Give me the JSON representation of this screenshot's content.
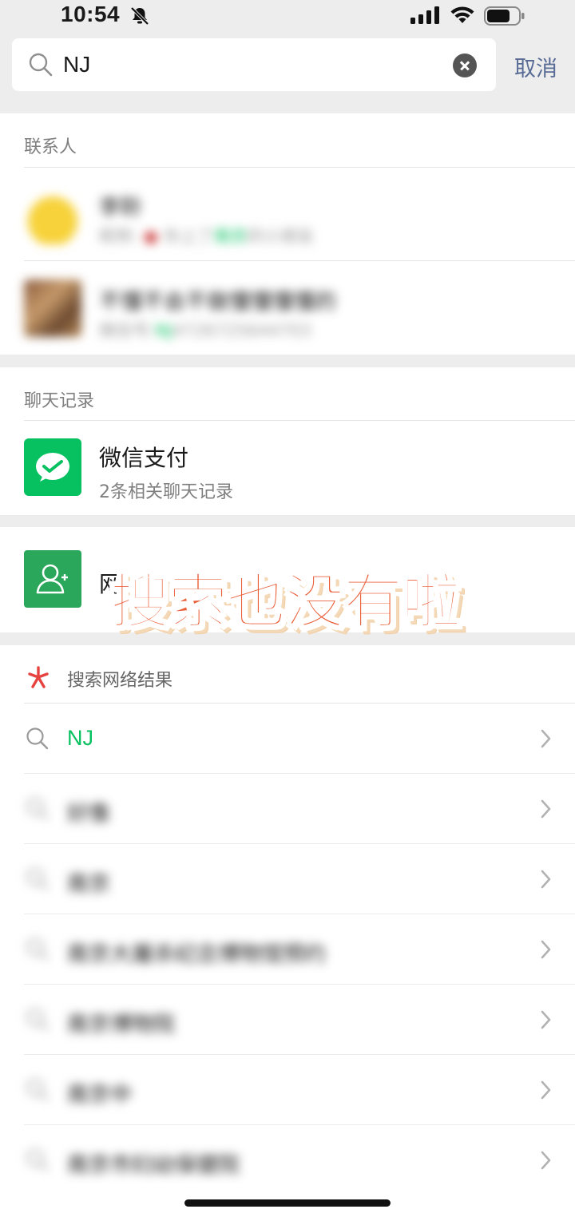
{
  "status_bar": {
    "time": "10:54"
  },
  "search": {
    "query": "NJ",
    "cancel_label": "取消"
  },
  "contacts": {
    "header": "联系人",
    "items": [
      {
        "name": "李聆",
        "sub_prefix": "昵称:",
        "sub_mid": "你上了",
        "sub_match": "南京",
        "sub_suffix": "的小朋友"
      },
      {
        "name": "不懂不会不做懂懂懂懂的",
        "sub_prefix": "微信号:",
        "sub_match": "NJ",
        "sub_suffix": "4726725644703"
      }
    ]
  },
  "chat_records": {
    "header": "聊天记录",
    "items": [
      {
        "title": "微信支付",
        "sub": "2条相关聊天记录"
      }
    ]
  },
  "add_friend": {
    "label_visible": "网"
  },
  "overlay_text": "搜索也没有啦",
  "web_results": {
    "header": "搜索网络结果",
    "items": [
      {
        "text": "NJ",
        "blurred": false
      },
      {
        "text": "好像",
        "blurred": true
      },
      {
        "text": "南京",
        "blurred": true
      },
      {
        "text": "南京大屠杀纪念博物馆预约",
        "blurred": true
      },
      {
        "text": "南京博物院",
        "blurred": true
      },
      {
        "text": "南京中",
        "blurred": true
      },
      {
        "text": "南京市妇幼保健院",
        "blurred": true
      }
    ]
  },
  "colors": {
    "accent_green": "#07c160",
    "link_blue": "#576b95",
    "overlay_red": "#e95d37"
  }
}
